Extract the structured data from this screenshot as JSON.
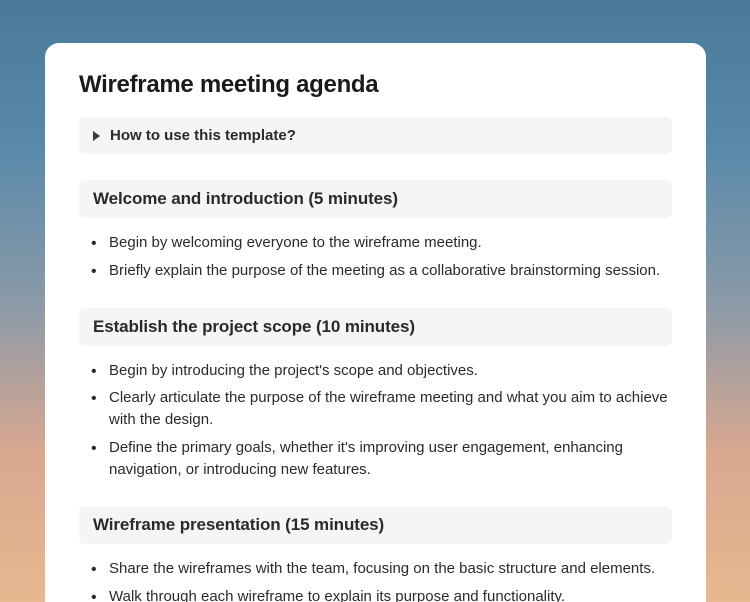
{
  "title": "Wireframe meeting agenda",
  "hint": {
    "label": "How to use this template?"
  },
  "sections": [
    {
      "heading": "Welcome and introduction (5 minutes)",
      "items": [
        "Begin by welcoming everyone to the wireframe meeting.",
        "Briefly explain the purpose of the meeting as a collaborative brainstorming session."
      ]
    },
    {
      "heading": "Establish the project scope (10 minutes)",
      "items": [
        "Begin by introducing the project's scope and objectives.",
        "Clearly articulate the purpose of the wireframe meeting and what you aim to achieve with the design.",
        "Define the primary goals, whether it's improving user engagement, enhancing navigation, or introducing new features."
      ]
    },
    {
      "heading": "Wireframe presentation (15 minutes)",
      "items": [
        "Share the wireframes with the team, focusing on the basic structure and elements.",
        "Walk through each wireframe to explain its purpose and functionality."
      ]
    }
  ]
}
